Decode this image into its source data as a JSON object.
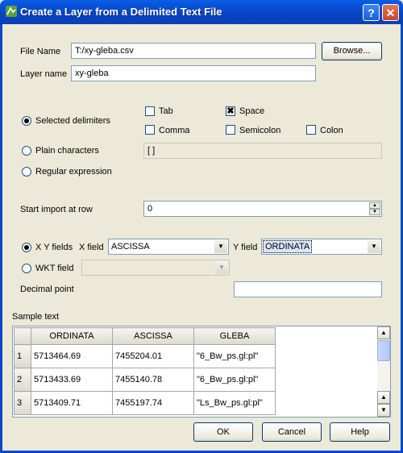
{
  "window": {
    "title": "Create a Layer from a Delimited Text File",
    "help_label": "?",
    "close_label": "✕"
  },
  "file": {
    "label": "File Name",
    "value": "T:/xy-gleba.csv",
    "browse_label": "Browse..."
  },
  "layer": {
    "label": "Layer name",
    "value": "xy-gleba"
  },
  "delimiters": {
    "selected_label": "Selected delimiters",
    "plain_label": "Plain characters",
    "plain_value": "[ ]",
    "regex_label": "Regular expression",
    "mode": "selected",
    "options": {
      "tab": "Tab",
      "space": "Space",
      "comma": "Comma",
      "semicolon": "Semicolon",
      "colon": "Colon"
    },
    "checked": {
      "tab": false,
      "space": true,
      "comma": false,
      "semicolon": false,
      "colon": false
    }
  },
  "start_row": {
    "label": "Start import at row",
    "value": "0"
  },
  "geometry": {
    "xy_label": "X Y fields",
    "xfield_label": "X field",
    "xfield_value": "ASCISSA",
    "yfield_label": "Y field",
    "yfield_value": "ORDINATA",
    "wkt_label": "WKT field",
    "wkt_value": "",
    "mode": "xy"
  },
  "decimal": {
    "label": "Decimal point",
    "value": ""
  },
  "sample": {
    "label": "Sample text",
    "columns": [
      "ORDINATA",
      "ASCISSA",
      "GLEBA"
    ],
    "rows": [
      {
        "num": "1",
        "cells": [
          "5713464.69",
          "7455204.01",
          "\"6_Bw_ps.gl:pl\""
        ]
      },
      {
        "num": "2",
        "cells": [
          "5713433.69",
          "7455140.78",
          "\"6_Bw_ps.gl:pl\""
        ]
      },
      {
        "num": "3",
        "cells": [
          "5713409.71",
          "7455197.74",
          "\"Ls_Bw_ps.gl:pl\""
        ]
      }
    ]
  },
  "buttons": {
    "ok": "OK",
    "cancel": "Cancel",
    "help": "Help"
  },
  "icons": {
    "title": "qgis-icon",
    "check": "✖",
    "dropdown": "▼",
    "up": "▲"
  },
  "colors": {
    "titlebar": "#0a5ee6",
    "dialog": "#ece9d8",
    "border": "#7f9db9"
  }
}
